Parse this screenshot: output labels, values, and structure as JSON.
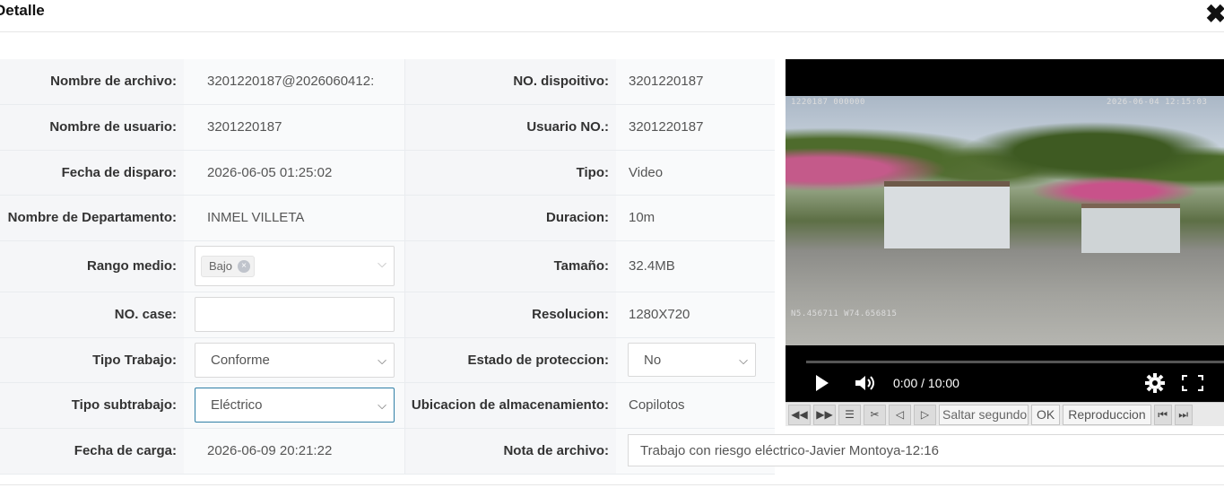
{
  "dialog": {
    "title": "Detalle",
    "close_icon": "close-icon"
  },
  "left": {
    "file_name_label": "Nombre de archivo:",
    "file_name_value": "3201220187@2026060412:",
    "user_name_label": "Nombre de usuario:",
    "user_name_value": "3201220187",
    "shot_date_label": "Fecha de disparo:",
    "shot_date_value": "2026-06-05 01:25:02",
    "department_label": "Nombre de Departamento:",
    "department_value": "INMEL VILLETA",
    "range_label": "Rango medio:",
    "range_tag": "Bajo",
    "case_label": "NO. case:",
    "case_value": "",
    "work_type_label": "Tipo Trabajo:",
    "work_type_value": "Conforme",
    "subwork_type_label": "Tipo subtrabajo:",
    "subwork_type_value": "Eléctrico",
    "upload_date_label": "Fecha de carga:",
    "upload_date_value": "2026-06-09 20:21:22"
  },
  "right": {
    "device_label": "NO. dispoitivo:",
    "device_value": "3201220187",
    "user_no_label": "Usuario NO.:",
    "user_no_value": "3201220187",
    "type_label": "Tipo:",
    "type_value": "Video",
    "duration_label": "Duracion:",
    "duration_value": "10m",
    "size_label": "Tamaño:",
    "size_value": "32.4MB",
    "resolution_label": "Resolucion:",
    "resolution_value": "1280X720",
    "protection_label": "Estado de proteccion:",
    "protection_value": "No",
    "storage_label": "Ubicacion de almacenamiento:",
    "storage_value": "Copilotos",
    "note_label": "Nota de archivo:",
    "note_value": "Trabajo con riesgo eléctrico-Javier Montoya-12:16"
  },
  "player": {
    "osd_top_left": "1220187 000000",
    "osd_top_right": "2026-06-04 12:15:03",
    "osd_coords": "N5.456711 W74.656815",
    "time_display": "0:00 / 10:00",
    "progress": 0,
    "toolbar": {
      "skip_placeholder": "Saltar segundo",
      "ok_label": "OK",
      "playback_label": "Reproduccion"
    }
  }
}
